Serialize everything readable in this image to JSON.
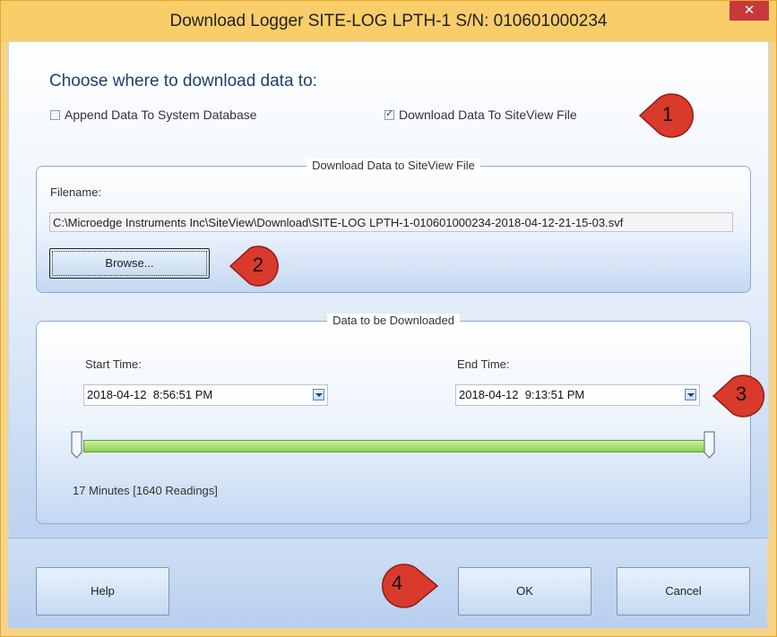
{
  "window": {
    "title": "Download Logger SITE-LOG LPTH-1 S/N: 010601000234",
    "close_glyph": "✕"
  },
  "destination": {
    "heading": "Choose where to download data to:",
    "append_db_label": "Append Data To System Database",
    "append_db_checked": false,
    "download_file_label": "Download Data To SiteView File",
    "download_file_checked": true
  },
  "file_group": {
    "legend": "Download Data to SiteView File",
    "filename_label": "Filename:",
    "filename_value": "C:\\Microedge Instruments Inc\\SiteView\\Download\\SITE-LOG LPTH-1-010601000234-2018-04-12-21-15-03.svf",
    "browse_label": "Browse..."
  },
  "data_group": {
    "legend": "Data to be Downloaded",
    "start_label": "Start Time:",
    "start_value": "2018-04-12  8:56:51 PM",
    "end_label": "End Time:",
    "end_value": "2018-04-12  9:13:51 PM",
    "range_start_fraction": 0,
    "range_end_fraction": 1,
    "summary": "17 Minutes [1640 Readings]"
  },
  "footer": {
    "help_label": "Help",
    "ok_label": "OK",
    "cancel_label": "Cancel"
  },
  "callouts": [
    "1",
    "2",
    "3",
    "4"
  ],
  "colors": {
    "title_bar": "#f8cd6a",
    "callout_red": "#d93a2b",
    "slider_green": "#8ed24f"
  }
}
